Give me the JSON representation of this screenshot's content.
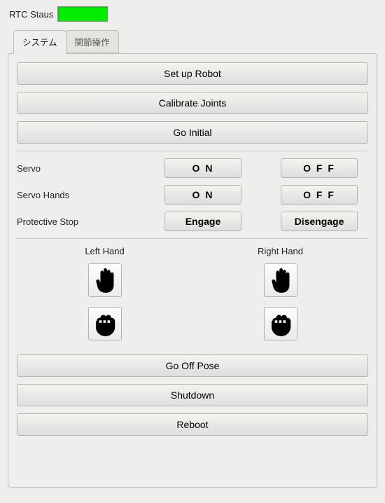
{
  "status": {
    "label": "RTC Staus",
    "color": "#00ee00"
  },
  "tabs": {
    "system": "システム",
    "joints": "関節操作",
    "active": "system"
  },
  "buttons": {
    "setup": "Set up Robot",
    "calibrate": "Calibrate Joints",
    "goinitial": "Go Initial",
    "gooff": "Go Off Pose",
    "shutdown": "Shutdown",
    "reboot": "Reboot"
  },
  "rows": {
    "servo": {
      "label": "Servo",
      "on": "O N",
      "off": "O F F"
    },
    "servo_hands": {
      "label": "Servo Hands",
      "on": "O N",
      "off": "O F F"
    },
    "protective": {
      "label": "Protective Stop",
      "on": "Engage",
      "off": "Disengage"
    }
  },
  "hands": {
    "left_title": "Left Hand",
    "right_title": "Right Hand"
  }
}
